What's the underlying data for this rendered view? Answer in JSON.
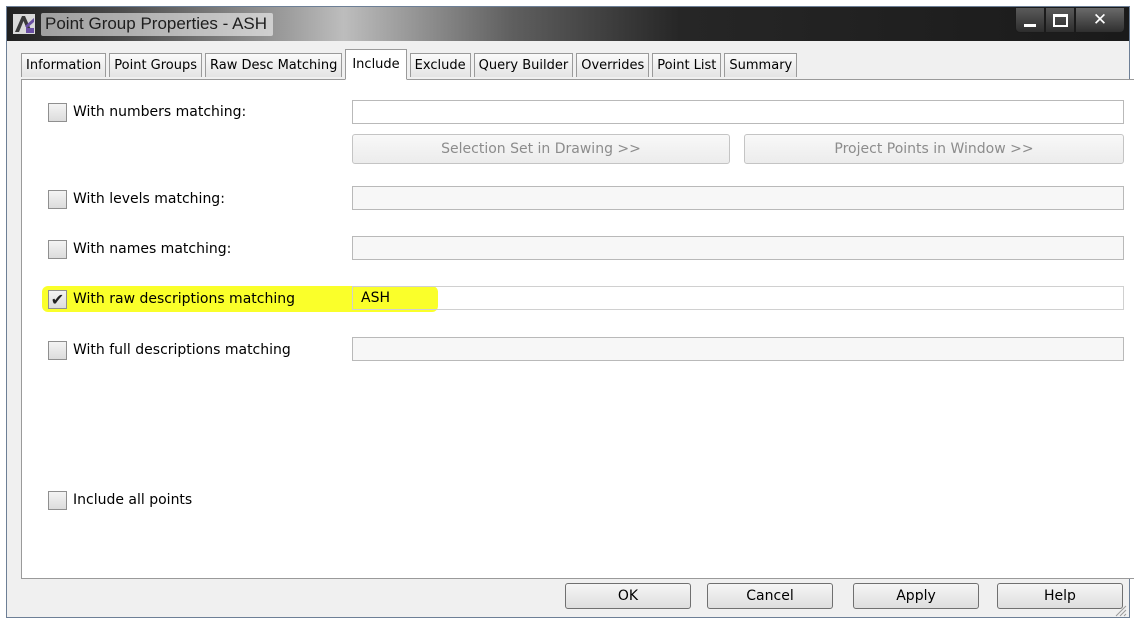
{
  "window": {
    "title": "Point Group Properties - ASH",
    "icon": "civil3d-app-icon",
    "controls": {
      "minimize": "minimize-icon",
      "maximize": "maximize-icon",
      "close": "✕"
    }
  },
  "tabs": [
    "Information",
    "Point Groups",
    "Raw Desc Matching",
    "Include",
    "Exclude",
    "Query Builder",
    "Overrides",
    "Point List",
    "Summary"
  ],
  "active_tab": "Include",
  "include": {
    "numbers": {
      "label": "With numbers matching:",
      "checked": false,
      "value": ""
    },
    "selection_set_button": "Selection Set in Drawing >>",
    "project_points_button": "Project Points in Window >>",
    "levels": {
      "label": "With levels matching:",
      "checked": false,
      "value": ""
    },
    "names": {
      "label": "With names matching:",
      "checked": false,
      "value": ""
    },
    "raw_descriptions": {
      "label": "With raw descriptions matching",
      "checked": true,
      "value": "ASH",
      "check_glyph": "✔"
    },
    "full_descriptions": {
      "label": "With full descriptions matching",
      "checked": false,
      "value": ""
    },
    "include_all": {
      "label": "Include all points",
      "checked": false
    }
  },
  "buttons": {
    "ok": "OK",
    "cancel": "Cancel",
    "apply": "Apply",
    "help": "Help"
  },
  "colors": {
    "highlight": "#faff2a",
    "titlebar_dark": "#1f1f1f"
  }
}
